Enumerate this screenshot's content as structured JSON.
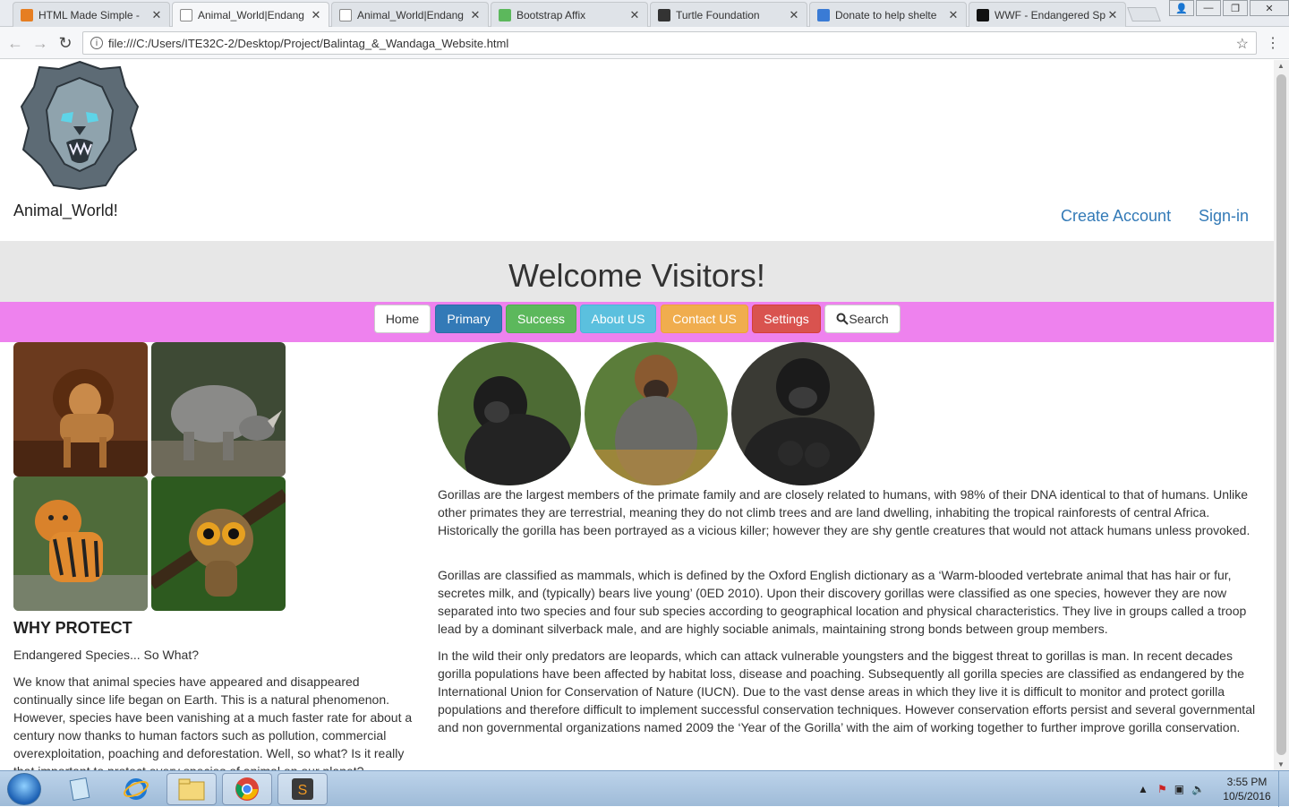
{
  "browser": {
    "tabs": [
      {
        "label": "HTML Made Simple - ",
        "favicon_color": "#e67e22",
        "active": false
      },
      {
        "label": "Animal_World|Endang",
        "favicon_color": "#888888",
        "active": true
      },
      {
        "label": "Animal_World|Endang",
        "favicon_color": "#888888",
        "active": false
      },
      {
        "label": "Bootstrap Affix",
        "favicon_color": "#5cb85c",
        "active": false
      },
      {
        "label": "Turtle Foundation",
        "favicon_color": "#333333",
        "active": false
      },
      {
        "label": "Donate to help shelte",
        "favicon_color": "#3a7bd5",
        "active": false
      },
      {
        "label": "WWF - Endangered Sp",
        "favicon_color": "#111111",
        "active": false
      }
    ],
    "url": "file:///C:/Users/ITE32C-2/Desktop/Project/Balintag_&_Wandaga_Website.html"
  },
  "header": {
    "brand": "Animal_World!",
    "create_account": "Create Account",
    "sign_in": "Sign-in"
  },
  "jumbotron": {
    "title": "Welcome Visitors!"
  },
  "nav": {
    "home": "Home",
    "primary": "Primary",
    "success": "Success",
    "about": "About US",
    "contact": "Contact US",
    "settings": "Settings",
    "search": "Search"
  },
  "left": {
    "heading": "WHY PROTECT",
    "subtitle": "Endangered Species... So What?",
    "paragraph": "We know that animal species have appeared and disappeared continually since life began on Earth. This is a natural phenomenon. However, species have been vanishing at a much faster rate for about a century now thanks to human factors such as pollution, commercial overexploitation, poaching and deforestation. Well, so what? Is it really that important to protect every species of animal on our planet?"
  },
  "main": {
    "p1": "Gorillas are the largest members of the primate family and are closely related to humans, with 98% of their DNA identical to that of humans. Unlike other primates they are terrestrial, meaning they do not climb trees and are land dwelling, inhabiting the tropical rainforests of central Africa. Historically the gorilla has been portrayed as a vicious killer; however they are shy gentle creatures that would not attack humans unless provoked.",
    "p2": "Gorillas are classified as mammals, which is defined by the Oxford English dictionary as a ‘Warm-blooded vertebrate animal that has hair or fur, secretes milk, and (typically) bears live young’ (0ED 2010). Upon their discovery gorillas were classified as one species, however they are now separated into two species and four sub species according to geographical location and physical characteristics. They live in groups called a troop lead by a dominant silverback male, and are highly sociable animals, maintaining strong bonds between group members.",
    "p3": "In the wild their only predators are leopards, which can attack vulnerable youngsters and the biggest threat to gorillas is man. In recent decades gorilla populations have been affected by habitat loss, disease and poaching. Subsequently all gorilla species are classified as endangered by the International Union for Conservation of Nature (IUCN). Due to the vast dense areas in which they live it is difficult to monitor and protect gorilla populations and therefore difficult to implement successful conservation techniques. However conservation efforts persist and several governmental and non governmental organizations named 2009 the ‘Year of the Gorilla’ with the aim of working together to further improve gorilla conservation."
  },
  "taskbar": {
    "time": "3:55 PM",
    "date": "10/5/2016"
  }
}
